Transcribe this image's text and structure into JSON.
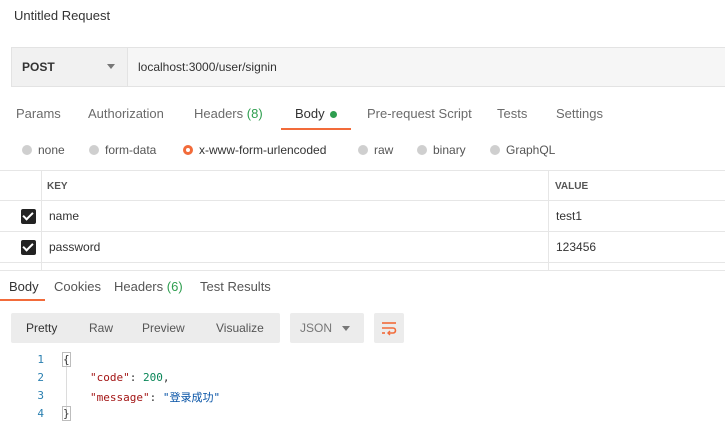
{
  "request": {
    "title": "Untitled Request",
    "method": "POST",
    "url": "localhost:3000/user/signin"
  },
  "request_tabs": [
    {
      "label": "Params"
    },
    {
      "label": "Authorization"
    },
    {
      "label": "Headers",
      "count": "(8)"
    },
    {
      "label": "Body",
      "active": true
    },
    {
      "label": "Pre-request Script"
    },
    {
      "label": "Tests"
    },
    {
      "label": "Settings"
    }
  ],
  "body_types": [
    {
      "label": "none"
    },
    {
      "label": "form-data"
    },
    {
      "label": "x-www-form-urlencoded",
      "selected": true
    },
    {
      "label": "raw"
    },
    {
      "label": "binary"
    },
    {
      "label": "GraphQL"
    }
  ],
  "params_table": {
    "headers": {
      "key": "KEY",
      "value": "VALUE"
    },
    "rows": [
      {
        "checked": true,
        "key": "name",
        "value": "test1"
      },
      {
        "checked": true,
        "key": "password",
        "value": "123456"
      }
    ]
  },
  "response_tabs": [
    {
      "label": "Body",
      "active": true
    },
    {
      "label": "Cookies"
    },
    {
      "label": "Headers",
      "count": "(6)"
    },
    {
      "label": "Test Results"
    }
  ],
  "format_buttons": [
    {
      "label": "Pretty",
      "active": true
    },
    {
      "label": "Raw"
    },
    {
      "label": "Preview"
    },
    {
      "label": "Visualize"
    }
  ],
  "format_select": {
    "value": "JSON"
  },
  "icons": {
    "wrap": "wrap-lines-icon",
    "caret": "chevron-down-icon"
  },
  "colors": {
    "accent": "#f26b3a",
    "count": "#2e9e4f"
  },
  "response_body": {
    "line_numbers": [
      "1",
      "2",
      "3",
      "4"
    ],
    "open_brace": "{",
    "close_brace": "}",
    "code_key": "\"code\"",
    "code_value": "200",
    "message_key": "\"message\"",
    "message_value": "\"登录成功\""
  }
}
